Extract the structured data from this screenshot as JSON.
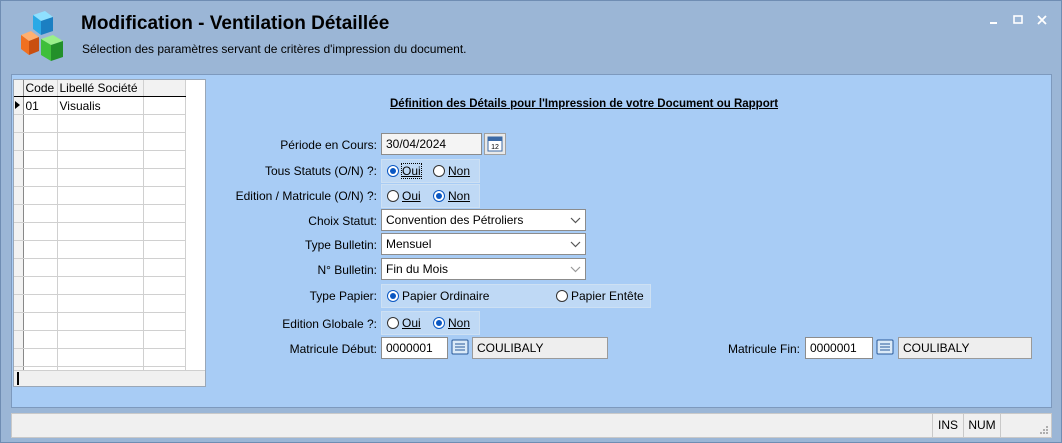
{
  "window": {
    "title": "Modification - Ventilation Détaillée",
    "subtitle": "Sélection des paramètres servant de critères d'impression du document.",
    "minimize_icon": "minimize-icon",
    "maximize_icon": "maximize-icon",
    "close_icon": "close-icon"
  },
  "grid": {
    "columns": [
      "Code",
      "Libellé Société"
    ],
    "rows": [
      {
        "code": "01",
        "label": "Visualis"
      }
    ]
  },
  "form": {
    "heading": "Définition des Détails pour l'Impression de votre Document ou Rapport",
    "periode": {
      "label": "Période en Cours:",
      "value": "30/04/2024",
      "icon": "calendar-icon"
    },
    "tous_statuts": {
      "label": "Tous Statuts (O/N) ?:",
      "oui": "Oui",
      "non": "Non",
      "selected": "Oui"
    },
    "edition_matricule": {
      "label": "Edition / Matricule (O/N) ?:",
      "oui": "Oui",
      "non": "Non",
      "selected": "Non"
    },
    "choix_statut": {
      "label": "Choix Statut:",
      "value": "Convention des Pétroliers"
    },
    "type_bulletin": {
      "label": "Type Bulletin:",
      "value": "Mensuel"
    },
    "no_bulletin": {
      "label": "N° Bulletin:",
      "value": "Fin du Mois"
    },
    "type_papier": {
      "label": "Type Papier:",
      "option1": "Papier Ordinaire",
      "option2": "Papier Entête",
      "selected": "Papier Ordinaire"
    },
    "edition_globale": {
      "label": "Edition Globale ?:",
      "oui": "Oui",
      "non": "Non",
      "selected": "Non"
    },
    "matricule_debut": {
      "label": "Matricule Début:",
      "value": "0000001",
      "name": "COULIBALY",
      "icon": "list-icon"
    },
    "matricule_fin": {
      "label": "Matricule Fin:",
      "value": "0000001",
      "name": "COULIBALY",
      "icon": "list-icon"
    }
  },
  "statusbar": {
    "ins": "INS",
    "num": "NUM"
  },
  "colors": {
    "window_bg": "#9bb6d6",
    "content_bg": "#a8ccf5",
    "radio_accent": "#0a57c2"
  }
}
